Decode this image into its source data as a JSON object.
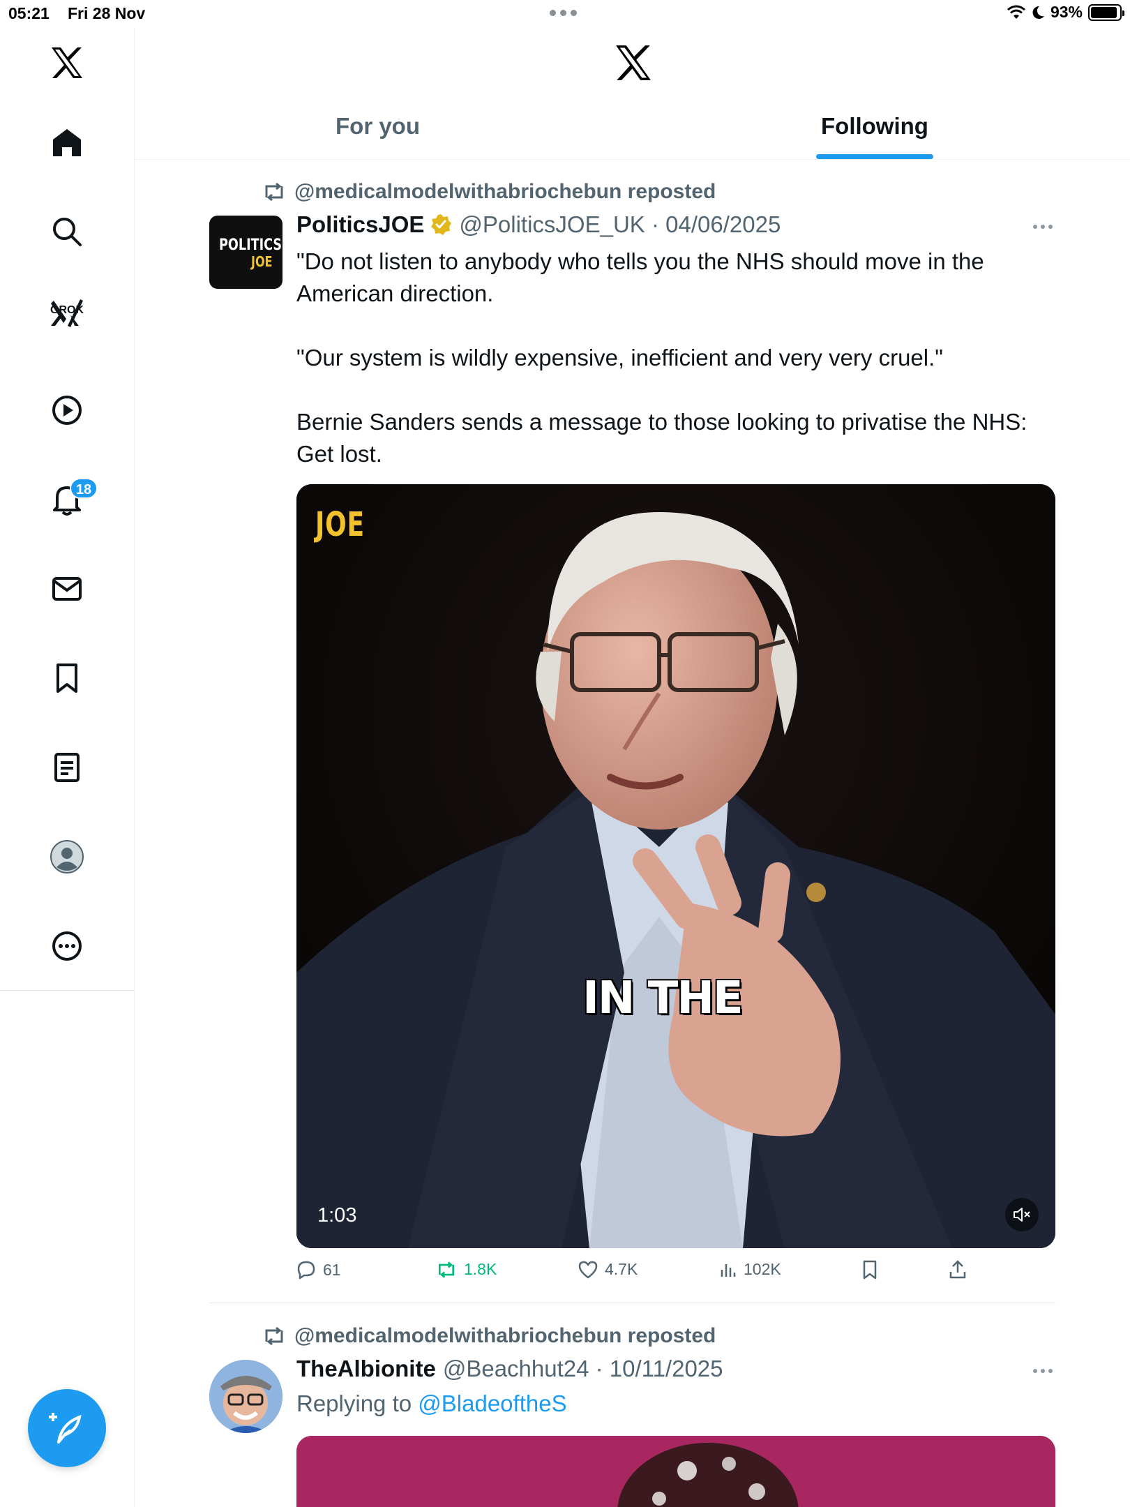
{
  "status_bar": {
    "time": "05:21",
    "date": "Fri 28 Nov",
    "battery": "93%",
    "battery_level": 0.93
  },
  "sidebar": {
    "grok_label": "GROK",
    "notifications_badge": "18"
  },
  "tabs": [
    {
      "label": "For you",
      "active": false
    },
    {
      "label": "Following",
      "active": true
    }
  ],
  "posts": [
    {
      "repost_by": "@medicalmodelwithabriochebun reposted",
      "avatar_text_top": "POLITICS",
      "avatar_text_bottom": "JOE",
      "name": "PoliticsJOE",
      "handle_date": "@PoliticsJOE_UK · 04/06/2025",
      "text": "\"Do not listen to anybody who tells you the NHS should move in the American direction.\n\n\"Our system is wildly expensive, inefficient and very very cruel.\"\n\nBernie Sanders sends a message to those looking to privatise the NHS: Get lost.",
      "media": {
        "logo": "JOE",
        "caption": "IN THE",
        "duration": "1:03"
      },
      "actions": {
        "replies": "61",
        "reposts": "1.8K",
        "likes": "4.7K",
        "views": "102K"
      }
    },
    {
      "repost_by": "@medicalmodelwithabriochebun reposted",
      "name": "TheAlbionite",
      "handle_date": "@Beachhut24 · 10/11/2025",
      "replying_prefix": "Replying to",
      "replying_to": "@BladeoftheS"
    }
  ],
  "colors": {
    "accent": "#1d9bf0",
    "repost_green": "#00ba7c",
    "secondary_text": "#536471",
    "verified_gold": "#e2b719"
  }
}
